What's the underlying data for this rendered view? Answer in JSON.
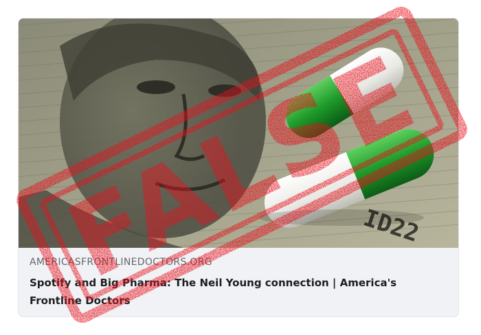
{
  "link_preview": {
    "domain": "AMERICASFRONTLINEDOCTORS.ORG",
    "title": "Spotify and Big Pharma: The Neil Young connection | America's Frontline Doctors"
  },
  "photo": {
    "description_icon": "banknote-with-pills-image",
    "banknote_serial_fragment": "ID22"
  },
  "stamp": {
    "label": "FALSE",
    "color": "#e8101c"
  }
}
